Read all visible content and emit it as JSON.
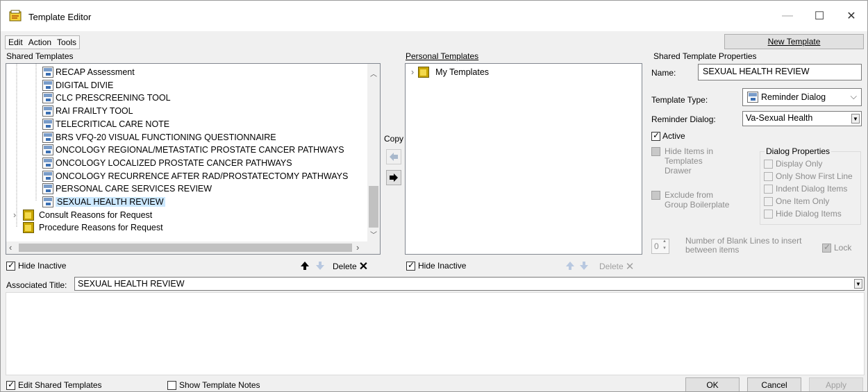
{
  "window": {
    "title": "Template Editor",
    "minimize_glyph": "—",
    "maximize_glyph": "☐",
    "close_glyph": "✕"
  },
  "menu": {
    "edit": "Edit",
    "action": "Action",
    "tools": "Tools"
  },
  "toolbar": {
    "new_template": "New Template"
  },
  "shared": {
    "header": "Shared Templates",
    "items": [
      "RECAP Assessment",
      "DIGITAL DIVIE",
      "CLC PRESCREENING TOOL",
      "RAI FRAILTY TOOL",
      "TELECRITICAL CARE NOTE",
      "BRS VFQ-20 VISUAL FUNCTIONING QUESTIONNAIRE",
      "ONCOLOGY REGIONAL/METASTATIC PROSTATE CANCER PATHWAYS",
      "ONCOLOGY LOCALIZED PROSTATE CANCER PATHWAYS",
      "ONCOLOGY RECURRENCE AFTER RAD/PROSTATECTOMY PATHWAYS",
      "PERSONAL CARE SERVICES REVIEW",
      "SEXUAL HEALTH REVIEW"
    ],
    "selected_index": 10,
    "folders": [
      "Consult Reasons for Request",
      "Procedure Reasons for Request"
    ],
    "hide_inactive": "Hide Inactive",
    "delete": "Delete"
  },
  "copy": {
    "label": "Copy"
  },
  "personal": {
    "header": "Personal Templates",
    "items": [
      "My Templates"
    ],
    "hide_inactive": "Hide Inactive",
    "delete": "Delete"
  },
  "properties": {
    "header": "Shared Template Properties",
    "name_label": "Name:",
    "name_value": "SEXUAL HEALTH REVIEW",
    "type_label": "Template Type:",
    "type_value": "Reminder Dialog",
    "reminder_label": "Reminder Dialog:",
    "reminder_value": "Va-Sexual Health",
    "active_label": "Active",
    "hide_items_label": [
      "Hide Items in",
      "Templates",
      "Drawer"
    ],
    "exclude_label": [
      "Exclude from",
      "Group Boilerplate"
    ],
    "dialog_props_header": "Dialog Properties",
    "dialog_props": [
      "Display Only",
      "Only Show First Line",
      "Indent Dialog Items",
      "One Item Only",
      "Hide Dialog Items"
    ],
    "blank_lines_value": "0",
    "blank_lines_label": [
      "Number of Blank Lines to insert",
      "between items"
    ],
    "lock_label": "Lock"
  },
  "associated": {
    "label": "Associated Title:",
    "value": "SEXUAL HEALTH REVIEW"
  },
  "footer": {
    "edit_shared": "Edit Shared Templates",
    "show_notes": "Show Template Notes",
    "ok": "OK",
    "cancel": "Cancel",
    "apply": "Apply"
  },
  "colors": {
    "selection": "#cce8ff",
    "window_bg": "#f0f0f0"
  }
}
